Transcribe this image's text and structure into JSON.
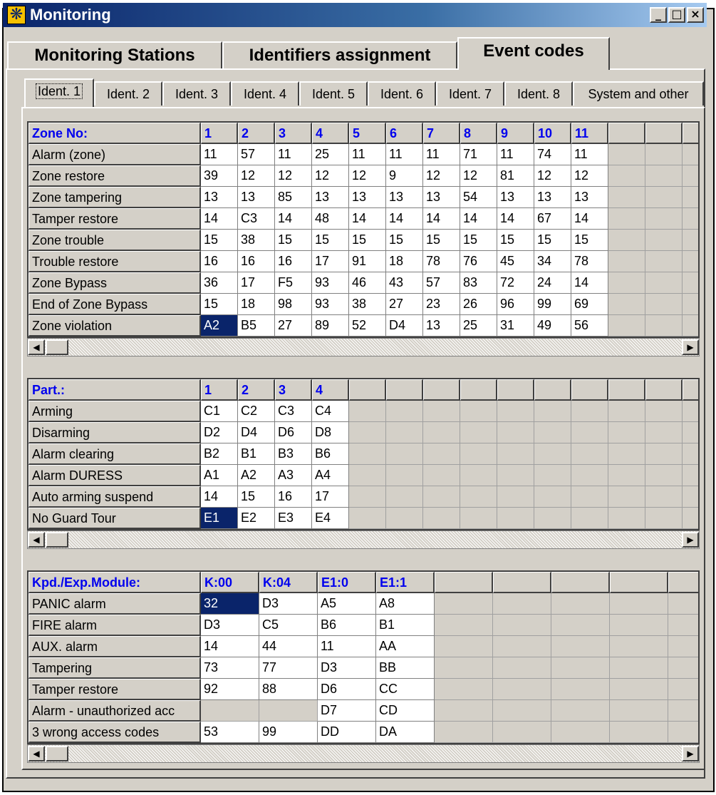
{
  "window": {
    "title": "Monitoring",
    "controls": {
      "minimize": "_",
      "maximize": "□",
      "close": "×"
    }
  },
  "main_tabs": [
    {
      "label": "Monitoring Stations",
      "active": false
    },
    {
      "label": "Identifiers assignment",
      "active": false
    },
    {
      "label": "Event codes",
      "active": true
    }
  ],
  "ident_tabs": [
    {
      "label": "Ident. 1",
      "active": true
    },
    {
      "label": "Ident. 2",
      "active": false
    },
    {
      "label": "Ident. 3",
      "active": false
    },
    {
      "label": "Ident. 4",
      "active": false
    },
    {
      "label": "Ident. 5",
      "active": false
    },
    {
      "label": "Ident. 6",
      "active": false
    },
    {
      "label": "Ident. 7",
      "active": false
    },
    {
      "label": "Ident. 8",
      "active": false
    },
    {
      "label": "System and other",
      "active": false
    }
  ],
  "zones": {
    "corner": "Zone No:",
    "columns": [
      "1",
      "2",
      "3",
      "4",
      "5",
      "6",
      "7",
      "8",
      "9",
      "10",
      "11"
    ],
    "rows": [
      {
        "label": "Alarm  (zone)",
        "values": [
          "11",
          "57",
          "11",
          "25",
          "11",
          "11",
          "11",
          "71",
          "11",
          "74",
          "11"
        ]
      },
      {
        "label": "Zone restore",
        "values": [
          "39",
          "12",
          "12",
          "12",
          "12",
          "9",
          "12",
          "12",
          "81",
          "12",
          "12"
        ]
      },
      {
        "label": "Zone tampering",
        "values": [
          "13",
          "13",
          "85",
          "13",
          "13",
          "13",
          "13",
          "54",
          "13",
          "13",
          "13"
        ]
      },
      {
        "label": "Tamper restore",
        "values": [
          "14",
          "C3",
          "14",
          "48",
          "14",
          "14",
          "14",
          "14",
          "14",
          "67",
          "14"
        ]
      },
      {
        "label": "Zone trouble",
        "values": [
          "15",
          "38",
          "15",
          "15",
          "15",
          "15",
          "15",
          "15",
          "15",
          "15",
          "15"
        ]
      },
      {
        "label": "Trouble restore",
        "values": [
          "16",
          "16",
          "16",
          "17",
          "91",
          "18",
          "78",
          "76",
          "45",
          "34",
          "78"
        ]
      },
      {
        "label": "Zone Bypass",
        "values": [
          "36",
          "17",
          "F5",
          "93",
          "46",
          "43",
          "57",
          "83",
          "72",
          "24",
          "14"
        ]
      },
      {
        "label": "End of Zone Bypass",
        "values": [
          "15",
          "18",
          "98",
          "93",
          "38",
          "27",
          "23",
          "26",
          "96",
          "99",
          "69"
        ]
      },
      {
        "label": "Zone violation",
        "values": [
          "A2",
          "B5",
          "27",
          "89",
          "52",
          "D4",
          "13",
          "25",
          "31",
          "49",
          "56"
        ]
      }
    ],
    "selected": {
      "row": 8,
      "col": 0
    }
  },
  "partitions": {
    "corner": "Part.:",
    "columns": [
      "1",
      "2",
      "3",
      "4"
    ],
    "rows": [
      {
        "label": "Arming",
        "values": [
          "C1",
          "C2",
          "C3",
          "C4"
        ]
      },
      {
        "label": "Disarming",
        "values": [
          "D2",
          "D4",
          "D6",
          "D8"
        ]
      },
      {
        "label": "Alarm clearing",
        "values": [
          "B2",
          "B1",
          "B3",
          "B6"
        ]
      },
      {
        "label": "Alarm DURESS",
        "values": [
          "A1",
          "A2",
          "A3",
          "A4"
        ]
      },
      {
        "label": "Auto arming suspend",
        "values": [
          "14",
          "15",
          "16",
          "17"
        ]
      },
      {
        "label": "No Guard Tour",
        "values": [
          "E1",
          "E2",
          "E3",
          "E4"
        ]
      }
    ],
    "selected": {
      "row": 5,
      "col": 0
    }
  },
  "modules": {
    "corner": "Kpd./Exp.Module:",
    "columns": [
      "K:00",
      "K:04",
      "E1:0",
      "E1:1"
    ],
    "rows": [
      {
        "label": "PANIC alarm",
        "values": [
          "32",
          "D3",
          "A5",
          "A8"
        ]
      },
      {
        "label": "FIRE alarm",
        "values": [
          "D3",
          "C5",
          "B6",
          "B1"
        ]
      },
      {
        "label": "AUX. alarm",
        "values": [
          "14",
          "44",
          "11",
          "AA"
        ]
      },
      {
        "label": "Tampering",
        "values": [
          "73",
          "77",
          "D3",
          "BB"
        ]
      },
      {
        "label": "Tamper restore",
        "values": [
          "92",
          "88",
          "D6",
          "CC"
        ]
      },
      {
        "label": "Alarm - unauthorized acc",
        "values": [
          "",
          "",
          "D7",
          "CD"
        ]
      },
      {
        "label": "3 wrong access codes",
        "values": [
          "53",
          "99",
          "DD",
          "DA"
        ]
      }
    ],
    "selected": {
      "row": 0,
      "col": 0
    }
  },
  "scrollbar": {
    "left_arrow": "◀",
    "right_arrow": "▶"
  },
  "colors": {
    "title_start": "#0a246a",
    "title_end": "#a6caf0",
    "header_text": "#0000ee",
    "selection": "#0a246a"
  }
}
